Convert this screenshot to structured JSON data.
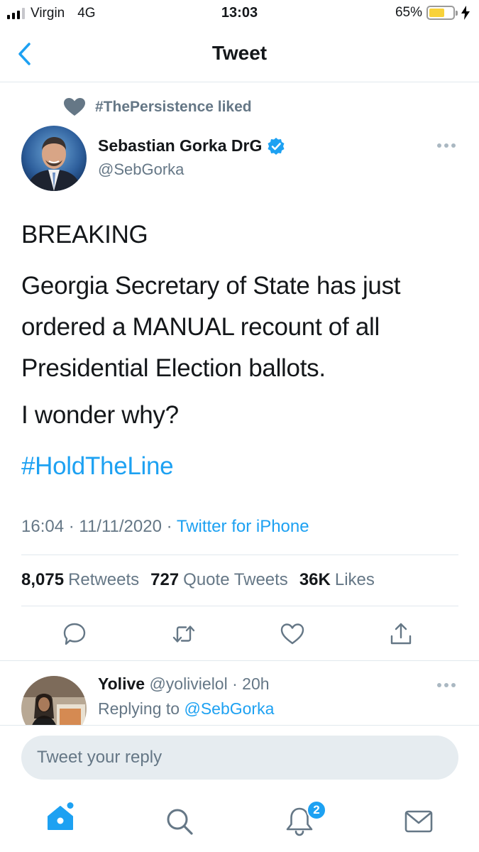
{
  "status_bar": {
    "carrier": "Virgin",
    "network": "4G",
    "time": "13:03",
    "battery_percent": "65%",
    "battery_level": 0.65
  },
  "nav": {
    "title": "Tweet",
    "back_icon": "chevron-left-icon"
  },
  "social_context": {
    "icon": "heart-icon",
    "text": "#ThePersistence liked"
  },
  "tweet": {
    "author_name": "Sebastian Gorka DrG",
    "author_handle": "@SebGorka",
    "verified": true,
    "paragraphs": [
      "BREAKING",
      "Georgia Secretary of State has just ordered a MANUAL recount of all Presidential Election ballots.",
      "I wonder why?"
    ],
    "hashtag": "#HoldTheLine",
    "timestamp": "16:04 · 11/11/2020 · ",
    "source": "Twitter for iPhone",
    "stats": {
      "retweets_count": "8,075",
      "retweets_label": "Retweets",
      "quotes_count": "727",
      "quotes_label": "Quote Tweets",
      "likes_count": "36K",
      "likes_label": "Likes"
    },
    "actions": [
      "reply-icon",
      "retweet-icon",
      "like-icon",
      "share-icon"
    ]
  },
  "reply": {
    "name": "Yolive",
    "handle": "@yolivielol",
    "time": "· 20h",
    "replying_prefix": "Replying to ",
    "replying_to": "@SebGorka"
  },
  "composer": {
    "placeholder": "Tweet your reply"
  },
  "tab_bar": {
    "items": [
      "home-icon",
      "search-icon",
      "notifications-icon",
      "messages-icon"
    ],
    "notifications_badge": "2"
  },
  "colors": {
    "accent": "#1da1f2",
    "secondary_text": "#657786",
    "primary_text": "#14171a",
    "battery_fill": "#f8d23a"
  }
}
